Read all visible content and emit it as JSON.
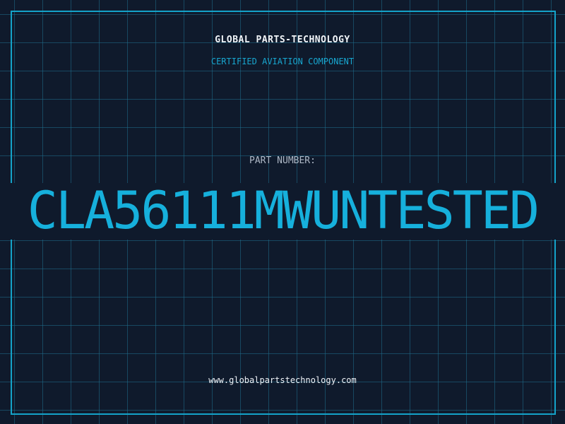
{
  "label": {
    "company": "GLOBAL PARTS-TECHNOLOGY",
    "subtitle": "CERTIFIED AVIATION COMPONENT",
    "part_number_label": "PART NUMBER:",
    "part_number": "CLA56111MWUNTESTED",
    "website": "www.globalpartstechnology.com"
  },
  "colors": {
    "background": "#0f1a2c",
    "grid": "#1e6e8c",
    "accent": "#16b0dc",
    "frame": "#14a3c9",
    "title_text": "#f1f5f9",
    "label_text": "#aeb8c6"
  }
}
